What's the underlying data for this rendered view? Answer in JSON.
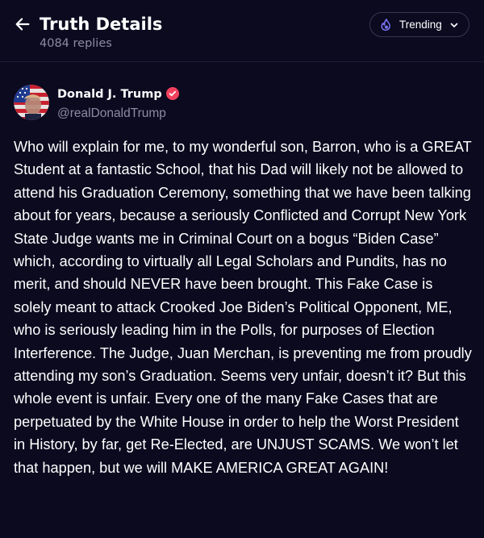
{
  "header": {
    "title": "Truth Details",
    "reply_count": "4084 replies",
    "sort_label": "Trending",
    "back_icon": "arrow-left-icon",
    "sort_icon": "flame-icon",
    "chevron_icon": "chevron-down-icon"
  },
  "post": {
    "author_name": "Donald J. Trump",
    "author_handle": "@realDonaldTrump",
    "verified": true,
    "body": "Who will explain for me, to my wonderful son, Barron, who is a GREAT Student at a fantastic School, that his Dad will likely not be allowed to attend his Graduation Ceremony, something that we have been talking about for years, because a seriously Conflicted and Corrupt New York State Judge wants me in Criminal Court on a bogus “Biden Case” which, according to virtually all Legal Scholars and Pundits, has no merit, and should NEVER have been brought. This Fake Case is solely meant to attack Crooked Joe Biden’s Political Opponent, ME, who is seriously leading him in the Polls, for purposes of Election Interference. The Judge, Juan Merchan, is preventing me from proudly attending my son’s Graduation. Seems very unfair, doesn’t it? But this whole event is unfair. Every one of the many Fake Cases that are perpetuated by the White House in order to help the Worst President in History, by far, get Re-Elected, are UNJUST SCAMS. We won’t let that happen, but we will MAKE AMERICA GREAT AGAIN!"
  },
  "colors": {
    "background": "#0b0a1f",
    "muted_text": "#8f8aa3",
    "accent": "#5448ee",
    "verified_badge": "#f3415e"
  }
}
